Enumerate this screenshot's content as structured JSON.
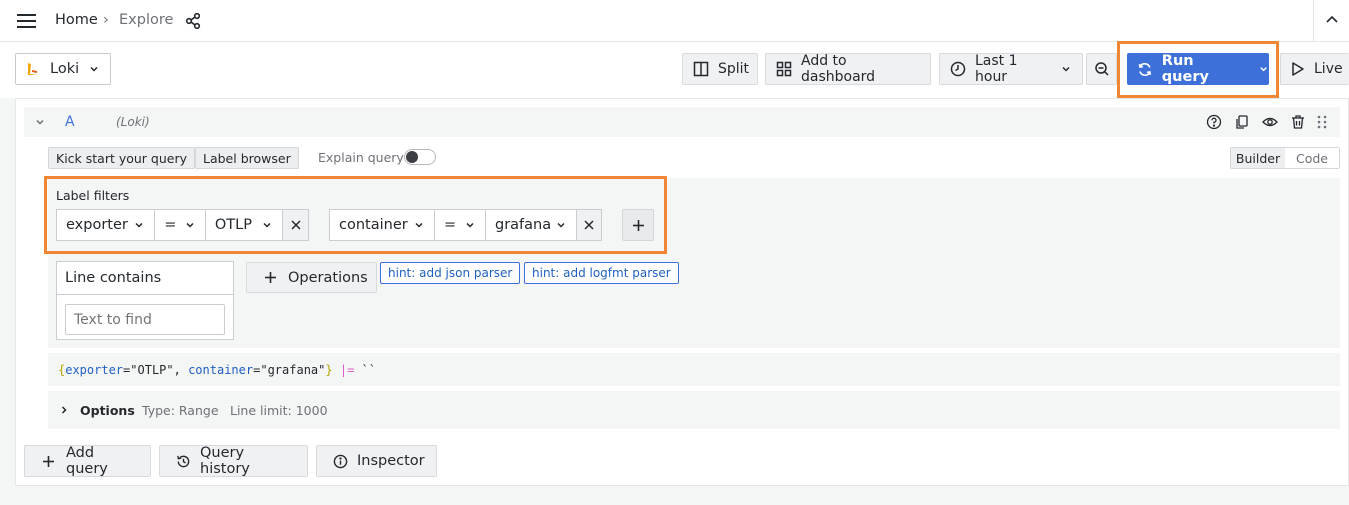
{
  "breadcrumb": {
    "home": "Home",
    "separator": "›",
    "current": "Explore"
  },
  "toolbar": {
    "datasource": "Loki",
    "split_label": "Split",
    "add_to_dashboard_label": "Add to dashboard",
    "time_range_label": "Last 1 hour",
    "run_query_label": "Run query",
    "live_label": "Live"
  },
  "query": {
    "ref_id": "A",
    "datasource_hint": "(Loki)",
    "kick_start_label": "Kick start your query",
    "label_browser_label": "Label browser",
    "explain_label": "Explain query",
    "mode_builder": "Builder",
    "mode_code": "Code",
    "label_filters_title": "Label filters",
    "filters": [
      {
        "label": "exporter",
        "op": "=",
        "value": "OTLP"
      },
      {
        "label": "container",
        "op": "=",
        "value": "grafana"
      }
    ],
    "line_contains_label": "Line contains",
    "text_to_find_placeholder": "Text to find",
    "operations_label": "Operations",
    "hints": [
      "hint: add json parser",
      "hint: add logfmt parser"
    ],
    "code": {
      "open_brace": "{",
      "key1": "exporter",
      "eq": "=",
      "val1": "\"OTLP\"",
      "comma": ", ",
      "key2": "container",
      "val2": "\"grafana\"",
      "close_brace": "}",
      "pipe": "|=",
      "backticks": "``"
    },
    "options_label": "Options",
    "options_type": "Type: Range",
    "options_line_limit": "Line limit: 1000"
  },
  "footer": {
    "add_query_label": "Add query",
    "query_history_label": "Query history",
    "inspector_label": "Inspector"
  },
  "colors": {
    "primary": "#3d71d9",
    "highlight": "#ef8734",
    "toggle_knob": "#3d3f44"
  }
}
